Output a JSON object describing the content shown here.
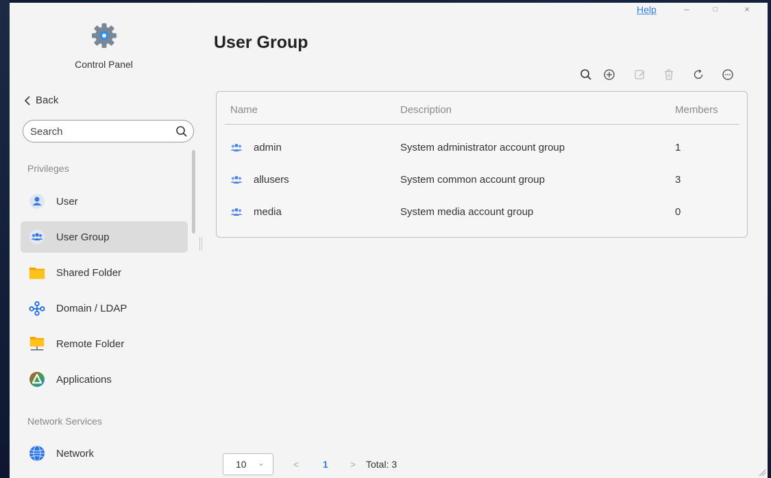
{
  "window": {
    "help_label": "Help",
    "minimize": "–",
    "maximize": "□",
    "close": "×"
  },
  "sidebar": {
    "app_title": "Control Panel",
    "back_label": "Back",
    "search": {
      "placeholder": "Search",
      "value": ""
    },
    "sections": {
      "privileges": "Privileges",
      "network_services": "Network Services"
    },
    "items": [
      {
        "label": "User",
        "icon": "user-icon"
      },
      {
        "label": "User Group",
        "icon": "user-group-icon",
        "active": true
      },
      {
        "label": "Shared Folder",
        "icon": "folder-icon"
      },
      {
        "label": "Domain / LDAP",
        "icon": "domain-icon"
      },
      {
        "label": "Remote Folder",
        "icon": "remote-folder-icon"
      },
      {
        "label": "Applications",
        "icon": "applications-icon"
      },
      {
        "label": "Network",
        "icon": "network-globe-icon"
      }
    ]
  },
  "main": {
    "title": "User Group",
    "toolbar": [
      "search-icon",
      "add-icon",
      "edit-icon",
      "delete-icon",
      "refresh-icon",
      "more-icon"
    ],
    "table": {
      "columns": [
        "Name",
        "Description",
        "Members"
      ],
      "rows": [
        {
          "name": "admin",
          "description": "System administrator account group",
          "members": "1"
        },
        {
          "name": "allusers",
          "description": "System common account group",
          "members": "3"
        },
        {
          "name": "media",
          "description": "System media account group",
          "members": "0"
        }
      ]
    },
    "pagination": {
      "page_size": "10",
      "prev": "<",
      "current_page": "1",
      "next": ">",
      "total": "Total: 3"
    }
  },
  "colors": {
    "accent": "#2f7fe0",
    "active_bg": "#dcdcdc",
    "group_icon": "#4a86e8"
  }
}
